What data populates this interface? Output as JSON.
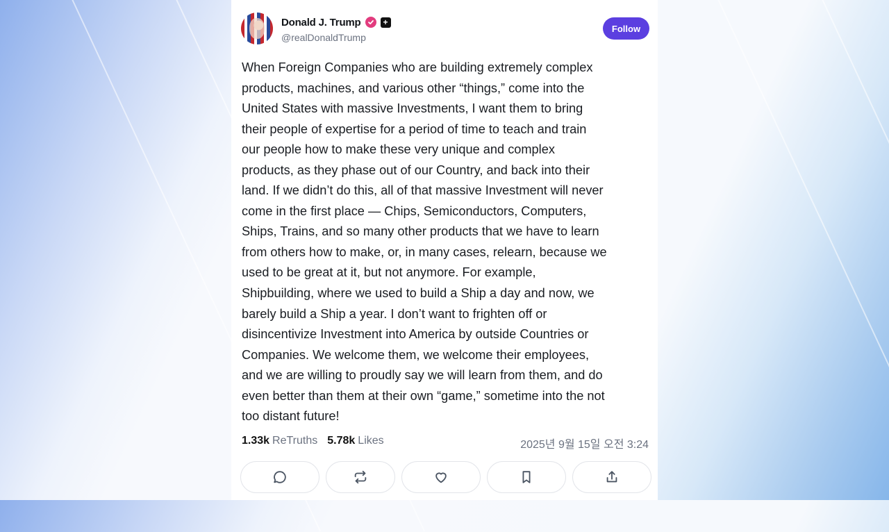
{
  "post": {
    "author_name": "Donald J. Trump",
    "author_handle": "@realDonaldTrump",
    "follow_label": "Follow",
    "text": "When Foreign Companies who are building extremely complex\nproducts, machines, and various other “things,” come into the\nUnited States with massive Investments, I want them to bring\ntheir people of expertise for a period of time to teach and train\nour people how to make these very unique and complex\nproducts, as they phase out of our Country, and back into their\nland. If we didn’t do this, all of that massive Investment will never\ncome in the first place — Chips, Semiconductors, Computers,\nShips, Trains, and so many other products that we have to learn\nfrom others how to make, or, in many cases, relearn, because we\nused to be great at it, but not anymore. For example,\nShipbuilding, where we used to build a Ship a day and now, we\nbarely build a Ship a year. I don’t want to frighten off or\ndisincentivize Investment into America by outside Countries or\nCompanies. We welcome them, we welcome their employees,\nand we are willing to proudly say we will learn from them, and do\neven better than them at their own “game,” sometime into the not\ntoo distant future!",
    "retruths_count": "1.33k",
    "retruths_label": "ReTruths",
    "likes_count": "5.78k",
    "likes_label": "Likes",
    "timestamp": "2025년 9월 15일 오전 3:24"
  },
  "actions": [
    {
      "name": "reply",
      "icon": "comment-icon"
    },
    {
      "name": "retruth",
      "icon": "repost-icon"
    },
    {
      "name": "like",
      "icon": "heart-icon"
    },
    {
      "name": "bookmark",
      "icon": "bookmark-icon"
    },
    {
      "name": "share",
      "icon": "share-icon"
    }
  ],
  "colors": {
    "follow_button": "#5b3fe0",
    "verified_badge": "#e23c7e",
    "text": "#1a1d22",
    "muted": "#6b7280"
  }
}
